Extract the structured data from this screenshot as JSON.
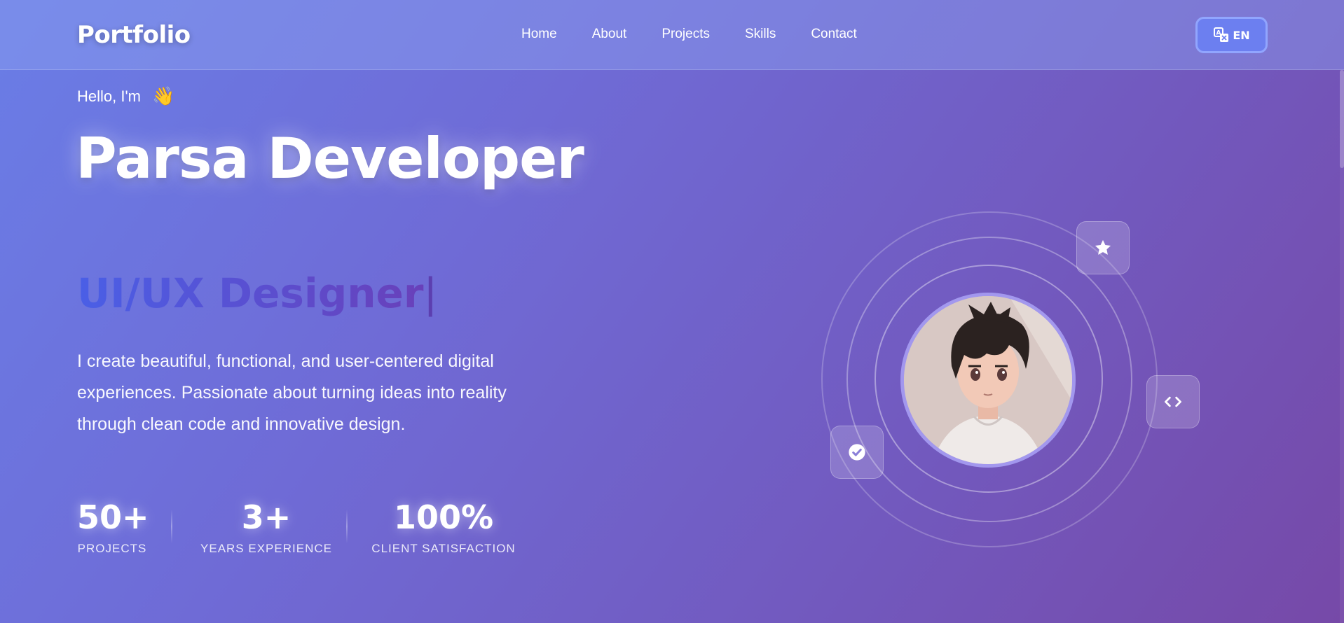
{
  "header": {
    "logo": "Portfolio",
    "nav": [
      "Home",
      "About",
      "Projects",
      "Skills",
      "Contact"
    ],
    "language_button": "EN"
  },
  "hero": {
    "greeting": "Hello, I'm",
    "greeting_emoji": "👋",
    "name": "Parsa Developer",
    "role": "UI/UX Designer",
    "caret": "|",
    "description": "I create beautiful, functional, and user-centered digital experiences. Passionate about turning ideas into reality through clean code and innovative design.",
    "stats": [
      {
        "value": "50+",
        "label": "PROJECTS"
      },
      {
        "value": "3+",
        "label": "YEARS EXPERIENCE"
      },
      {
        "value": "100%",
        "label": "CLIENT SATISFACTION"
      }
    ]
  },
  "floating_icons": [
    "star-icon",
    "code-icon",
    "check-circle-icon"
  ],
  "colors": {
    "accent": "#6c7ff0",
    "role_gradient_start": "#4a5fe6",
    "role_gradient_end": "#6a3fb8"
  }
}
